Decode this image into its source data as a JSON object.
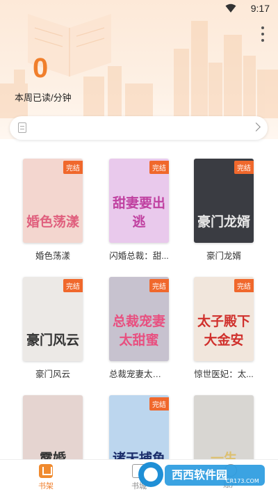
{
  "status_bar": {
    "time": "9:17"
  },
  "stats": {
    "count": "0",
    "label": "本周已读/分钟"
  },
  "books": [
    {
      "title": "婚色荡漾",
      "cover_text": "婚色荡漾",
      "badge": "完结",
      "cover_color": "#f3d6cf",
      "text_color": "#e0607e"
    },
    {
      "title": "闪婚总裁：甜...",
      "cover_text": "甜妻要出逃",
      "badge": "完结",
      "cover_color": "#e9c9ec",
      "text_color": "#c040a0"
    },
    {
      "title": "豪门龙婿",
      "cover_text": "豪门龙婿",
      "badge": "完结",
      "cover_color": "#3a3c42",
      "text_color": "#e8e8e8"
    },
    {
      "title": "豪门风云",
      "cover_text": "豪门风云",
      "badge": "完结",
      "cover_color": "#ece9e6",
      "text_color": "#333333"
    },
    {
      "title": "总裁宠妻太甜蜜",
      "cover_text": "总裁宠妻太甜蜜",
      "badge": "完结",
      "cover_color": "#c7c2cf",
      "text_color": "#e85080"
    },
    {
      "title": "惊世医妃：太...",
      "cover_text": "太子殿下大金安",
      "badge": "完结",
      "cover_color": "#f1e6dc",
      "text_color": "#d0302c"
    },
    {
      "title": "",
      "cover_text": "露婚",
      "badge": "",
      "cover_color": "#e5d4d0",
      "text_color": "#333333"
    },
    {
      "title": "",
      "cover_text": "诸天捕鱼",
      "badge": "完结",
      "cover_color": "#bcd6ee",
      "text_color": "#1a2c6a"
    },
    {
      "title": "",
      "cover_text": "一生",
      "badge": "",
      "cover_color": "#d8d6d2",
      "text_color": "#ddc070"
    }
  ],
  "tabs": [
    {
      "label": "书架",
      "icon": "bookshelf-icon",
      "active": true
    },
    {
      "label": "书城",
      "icon": "bookstore-icon",
      "active": false
    },
    {
      "label": "账户",
      "icon": "account-icon",
      "active": false
    }
  ],
  "watermark": {
    "brand": "西西软件园",
    "url": "CR173.COM"
  },
  "colors": {
    "accent": "#f07f2c",
    "badge": "#f0682c"
  }
}
